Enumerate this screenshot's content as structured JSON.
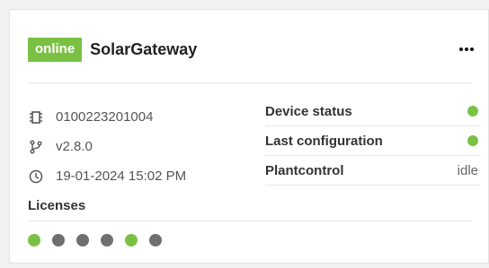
{
  "header": {
    "badge": "online",
    "title": "SolarGateway"
  },
  "info": {
    "serial": "0100223201004",
    "version": "v2.8.0",
    "timestamp": "19-01-2024 15:02 PM"
  },
  "status": {
    "rows": [
      {
        "label": "Device status",
        "state": "green-dot"
      },
      {
        "label": "Last configuration",
        "state": "green-dot"
      },
      {
        "label": "Plantcontrol",
        "value": "idle"
      }
    ]
  },
  "licenses": {
    "title": "Licenses",
    "dots": [
      "active",
      "inactive",
      "inactive",
      "inactive",
      "active",
      "inactive"
    ]
  },
  "colors": {
    "accent_green": "#7ac143",
    "inactive_gray": "#6f6f6f"
  }
}
